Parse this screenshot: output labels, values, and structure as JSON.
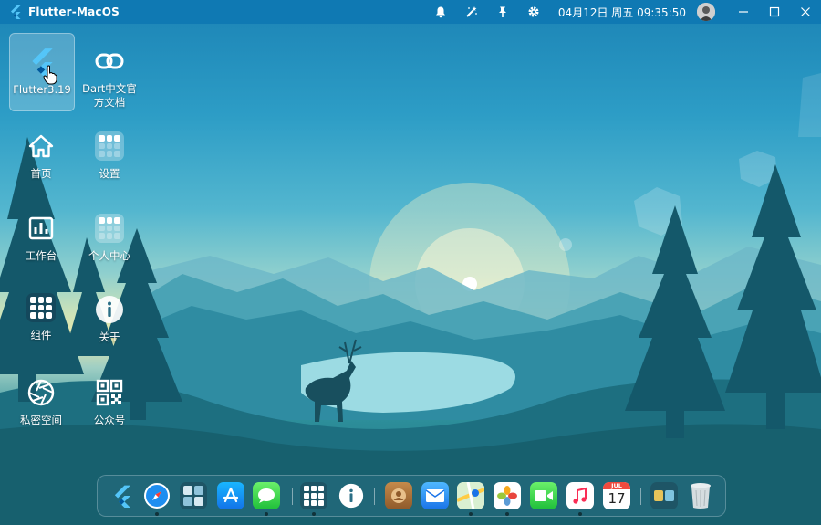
{
  "window": {
    "title": "Flutter-MacOS",
    "datetime": "04月12日 周五 09:35:50"
  },
  "topbar": {
    "icons": [
      "bell-icon",
      "magic-wand-icon",
      "pin-icon",
      "gear-icon",
      "avatar",
      "minimize-icon",
      "maximize-icon",
      "close-icon"
    ]
  },
  "desktop": {
    "icons": [
      {
        "label": "Flutter3.19",
        "icon": "flutter-icon"
      },
      {
        "label": "Dart中文官方文档",
        "icon": "link-icon"
      },
      {
        "label": "首页",
        "icon": "home-icon"
      },
      {
        "label": "设置",
        "icon": "settings-grid-icon"
      },
      {
        "label": "工作台",
        "icon": "dashboard-icon"
      },
      {
        "label": "个人中心",
        "icon": "profile-grid-icon"
      },
      {
        "label": "组件",
        "icon": "components-grid-icon"
      },
      {
        "label": "关于",
        "icon": "info-icon"
      },
      {
        "label": "私密空间",
        "icon": "aperture-icon"
      },
      {
        "label": "公众号",
        "icon": "qrcode-icon"
      }
    ]
  },
  "dock": {
    "items": [
      "flutter",
      "safari",
      "folder-grid",
      "app-store",
      "messages",
      "launchpad",
      "info",
      "contacts",
      "mail",
      "maps",
      "photos",
      "facetime",
      "music",
      "calendar",
      "folder",
      "trash"
    ],
    "calendar": {
      "month": "JUL",
      "day": "17"
    }
  },
  "colors": {
    "topbar": "#0f79b3",
    "flutter_light": "#54c5f8",
    "flutter_dark": "#01579b"
  }
}
